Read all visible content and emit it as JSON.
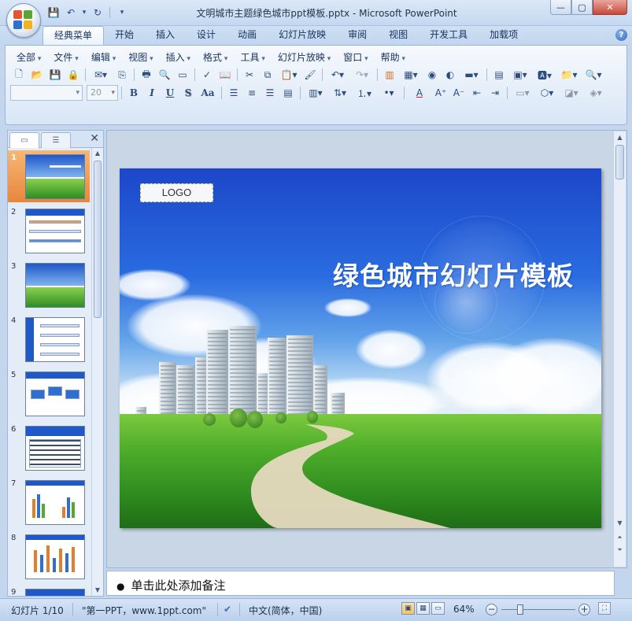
{
  "window": {
    "title": "文明城市主题绿色城市ppt模板.pptx - Microsoft PowerPoint",
    "controls": {
      "minimize": "—",
      "maximize": "▢",
      "close": "✕"
    }
  },
  "quick_access": {
    "save": "💾",
    "undo": "↶",
    "undo_dd": "▾",
    "redo": "↻",
    "customize": "▾"
  },
  "tabs": [
    {
      "label": "经典菜单",
      "active": true
    },
    {
      "label": "开始"
    },
    {
      "label": "插入"
    },
    {
      "label": "设计"
    },
    {
      "label": "动画"
    },
    {
      "label": "幻灯片放映"
    },
    {
      "label": "审阅"
    },
    {
      "label": "视图"
    },
    {
      "label": "开发工具"
    },
    {
      "label": "加载项"
    }
  ],
  "help": "?",
  "menus": [
    "全部",
    "文件",
    "编辑",
    "视图",
    "插入",
    "格式",
    "工具",
    "幻灯片放映",
    "窗口",
    "帮助"
  ],
  "toolbar": {
    "font_name": "",
    "font_size": "20",
    "bold": "B",
    "italic": "I",
    "underline": "U",
    "shadow": "S",
    "change_case": "Aa",
    "font_color": "A"
  },
  "panel": {
    "close": "✕"
  },
  "thumbnails": [
    "1",
    "2",
    "3",
    "4",
    "5",
    "6",
    "7",
    "8",
    "9"
  ],
  "slide": {
    "logo": "LOGO",
    "title": "绿色城市幻灯片模板"
  },
  "notes": {
    "placeholder": "单击此处添加备注"
  },
  "status": {
    "slide_counter": "幻灯片 1/10",
    "theme": "\"第一PPT，www.1ppt.com\"",
    "language": "中文(简体，中国)",
    "zoom": "64%",
    "zoom_out": "−",
    "zoom_in": "+"
  },
  "colors": {
    "accent": "#2a6ce0",
    "selection": "#e8863c",
    "ribbon": "#dbe8f7"
  }
}
